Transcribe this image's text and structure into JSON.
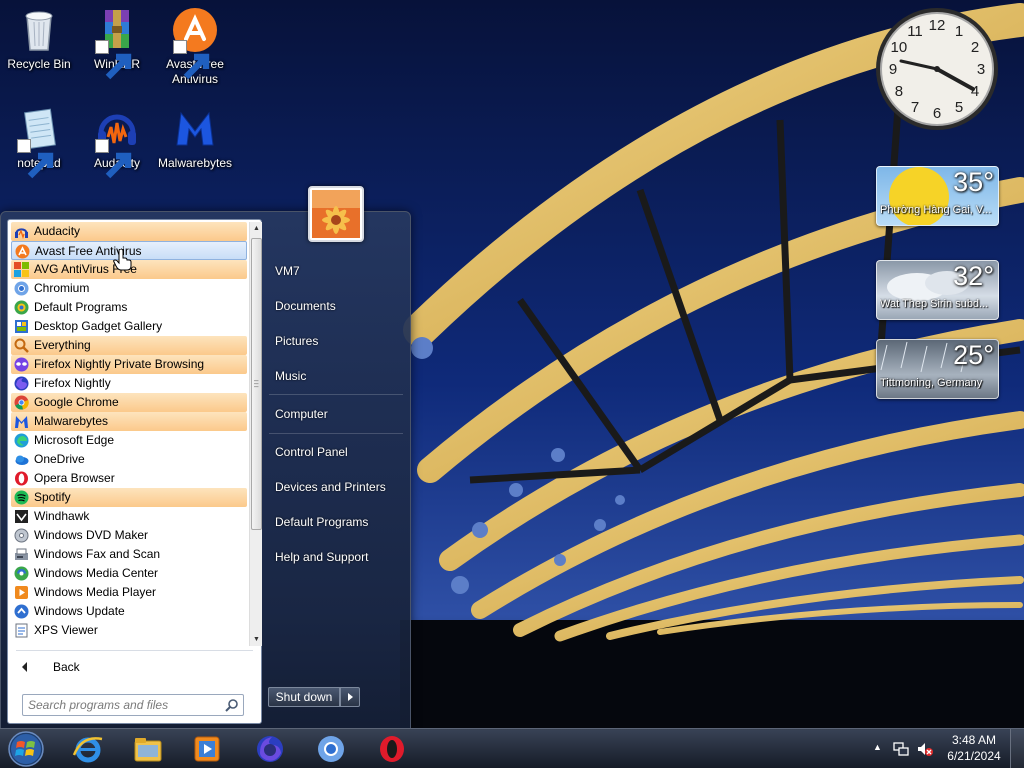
{
  "desktop": {
    "icons": [
      {
        "label": "Recycle Bin",
        "icon": "recycle-bin-icon"
      },
      {
        "label": "WinRAR",
        "icon": "winrar-icon"
      },
      {
        "label": "Avast Free Antivirus",
        "icon": "avast-icon"
      },
      {
        "label": "notepad",
        "icon": "notepad-icon"
      },
      {
        "label": "Audacity",
        "icon": "audacity-icon"
      },
      {
        "label": "Malwarebytes",
        "icon": "malwarebytes-icon"
      }
    ]
  },
  "gadgets": {
    "clock": {
      "numbers": [
        "12",
        "1",
        "2",
        "3",
        "4",
        "5",
        "6",
        "7",
        "8",
        "9",
        "10",
        "11"
      ],
      "time": "3:48"
    },
    "weather": [
      {
        "temp": "35°",
        "location": "Phường Hàng Gai, V...",
        "condition": "sunny"
      },
      {
        "temp": "32°",
        "location": "Wat Thep Sirin subd...",
        "condition": "cloudy"
      },
      {
        "temp": "25°",
        "location": "Tittmoning, Germany",
        "condition": "rain"
      }
    ]
  },
  "start_menu": {
    "programs": [
      {
        "label": "Audacity",
        "icon": "audacity-icon",
        "state": "new"
      },
      {
        "label": "Avast Free Antivirus",
        "icon": "avast-icon",
        "state": "selected"
      },
      {
        "label": "AVG AntiVirus Free",
        "icon": "avg-icon",
        "state": "new"
      },
      {
        "label": "Chromium",
        "icon": "chromium-icon",
        "state": ""
      },
      {
        "label": "Default Programs",
        "icon": "default-programs-icon",
        "state": ""
      },
      {
        "label": "Desktop Gadget Gallery",
        "icon": "gadget-gallery-icon",
        "state": ""
      },
      {
        "label": "Everything",
        "icon": "everything-icon",
        "state": "new"
      },
      {
        "label": "Firefox Nightly Private Browsing",
        "icon": "firefox-private-icon",
        "state": "new"
      },
      {
        "label": "Firefox Nightly",
        "icon": "firefox-nightly-icon",
        "state": ""
      },
      {
        "label": "Google Chrome",
        "icon": "chrome-icon",
        "state": "new"
      },
      {
        "label": "Malwarebytes",
        "icon": "malwarebytes-icon",
        "state": "new"
      },
      {
        "label": "Microsoft Edge",
        "icon": "edge-icon",
        "state": ""
      },
      {
        "label": "OneDrive",
        "icon": "onedrive-icon",
        "state": ""
      },
      {
        "label": "Opera Browser",
        "icon": "opera-icon",
        "state": ""
      },
      {
        "label": "Spotify",
        "icon": "spotify-icon",
        "state": "new"
      },
      {
        "label": "Windhawk",
        "icon": "windhawk-icon",
        "state": ""
      },
      {
        "label": "Windows DVD Maker",
        "icon": "dvd-maker-icon",
        "state": ""
      },
      {
        "label": "Windows Fax and Scan",
        "icon": "fax-scan-icon",
        "state": ""
      },
      {
        "label": "Windows Media Center",
        "icon": "media-center-icon",
        "state": ""
      },
      {
        "label": "Windows Media Player",
        "icon": "media-player-icon",
        "state": ""
      },
      {
        "label": "Windows Update",
        "icon": "windows-update-icon",
        "state": ""
      },
      {
        "label": "XPS Viewer",
        "icon": "xps-viewer-icon",
        "state": ""
      }
    ],
    "back_label": "Back",
    "search_placeholder": "Search programs and files",
    "right_items": [
      "VM7",
      "Documents",
      "Pictures",
      "Music",
      "Computer",
      "Control Panel",
      "Devices and Printers",
      "Default Programs",
      "Help and Support"
    ],
    "shutdown_label": "Shut down"
  },
  "taskbar": {
    "apps": [
      "internet-explorer-icon",
      "file-explorer-icon",
      "media-player-icon",
      "firefox-icon",
      "chromium-icon",
      "opera-icon"
    ],
    "time": "3:48 AM",
    "date": "6/21/2024"
  },
  "colors": {
    "new_program_highlight": "#fbc98b",
    "selected_highlight": "#c8ddf7",
    "start_menu_bg": "#263860"
  }
}
